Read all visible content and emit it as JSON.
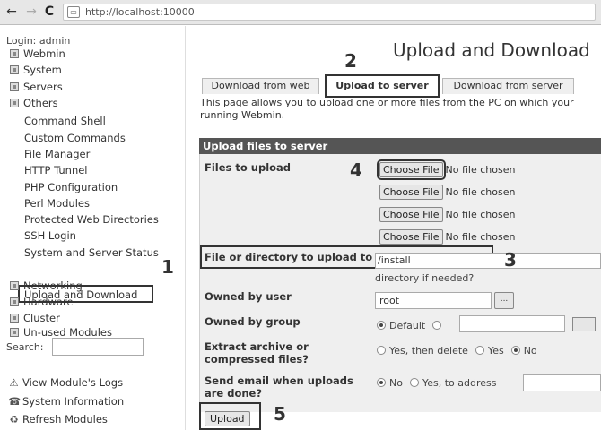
{
  "browser": {
    "back_glyph": "←",
    "forward_glyph": "→",
    "reload_glyph": "C",
    "url_icon": "page-icon",
    "url": "http://localhost:10000"
  },
  "sidebar": {
    "login": "Login: admin",
    "categories": {
      "webmin": "Webmin",
      "system": "System",
      "servers": "Servers",
      "others": "Others",
      "networking": "Networking",
      "hardware": "Hardware",
      "cluster": "Cluster",
      "unused": "Un-used Modules"
    },
    "others_items": [
      "Command Shell",
      "Custom Commands",
      "File Manager",
      "HTTP Tunnel",
      "PHP Configuration",
      "Perl Modules",
      "Protected Web Directories",
      "SSH Login",
      "System and Server Status",
      "Upload and Download"
    ],
    "search_label": "Search:",
    "search_value": "",
    "bottom_links": [
      {
        "icon": "warning-icon",
        "glyph": "⚠",
        "label": "View Module's Logs"
      },
      {
        "icon": "info-icon",
        "glyph": "☎",
        "label": "System Information"
      },
      {
        "icon": "refresh-icon",
        "glyph": "♻",
        "label": "Refresh Modules"
      }
    ]
  },
  "main": {
    "title": "Upload and Download",
    "tabs": [
      {
        "label": "Download from web",
        "active": false
      },
      {
        "label": "Upload to server",
        "active": true
      },
      {
        "label": "Download from server",
        "active": false
      }
    ],
    "intro_line1": "This page allows you to upload one or more files from the PC on which your",
    "intro_line2": "running Webmin.",
    "form": {
      "header": "Upload files to server",
      "files_label": "Files to upload",
      "choose_file_label": "Choose File",
      "no_file_text": "No file chosen",
      "dest_label": "File or directory to upload to",
      "dest_value": "/install",
      "dest_hint": "directory if needed?",
      "owner_label": "Owned by user",
      "owner_value": "root",
      "browse_label": "...",
      "group_label": "Owned by group",
      "group_default": "Default",
      "extract_label": "Extract archive or compressed files?",
      "extract_options": [
        "Yes, then delete",
        "Yes",
        "No"
      ],
      "extract_selected": "No",
      "email_label": "Send email when uploads are done?",
      "email_options": [
        "No",
        "Yes, to address"
      ],
      "email_selected": "No",
      "upload_button": "Upload"
    }
  },
  "annotations": [
    "1",
    "2",
    "3",
    "4",
    "5"
  ],
  "colors": {
    "form_header_bg": "#555555",
    "form_body_bg": "#efefef",
    "highlight_border": "#333333"
  }
}
